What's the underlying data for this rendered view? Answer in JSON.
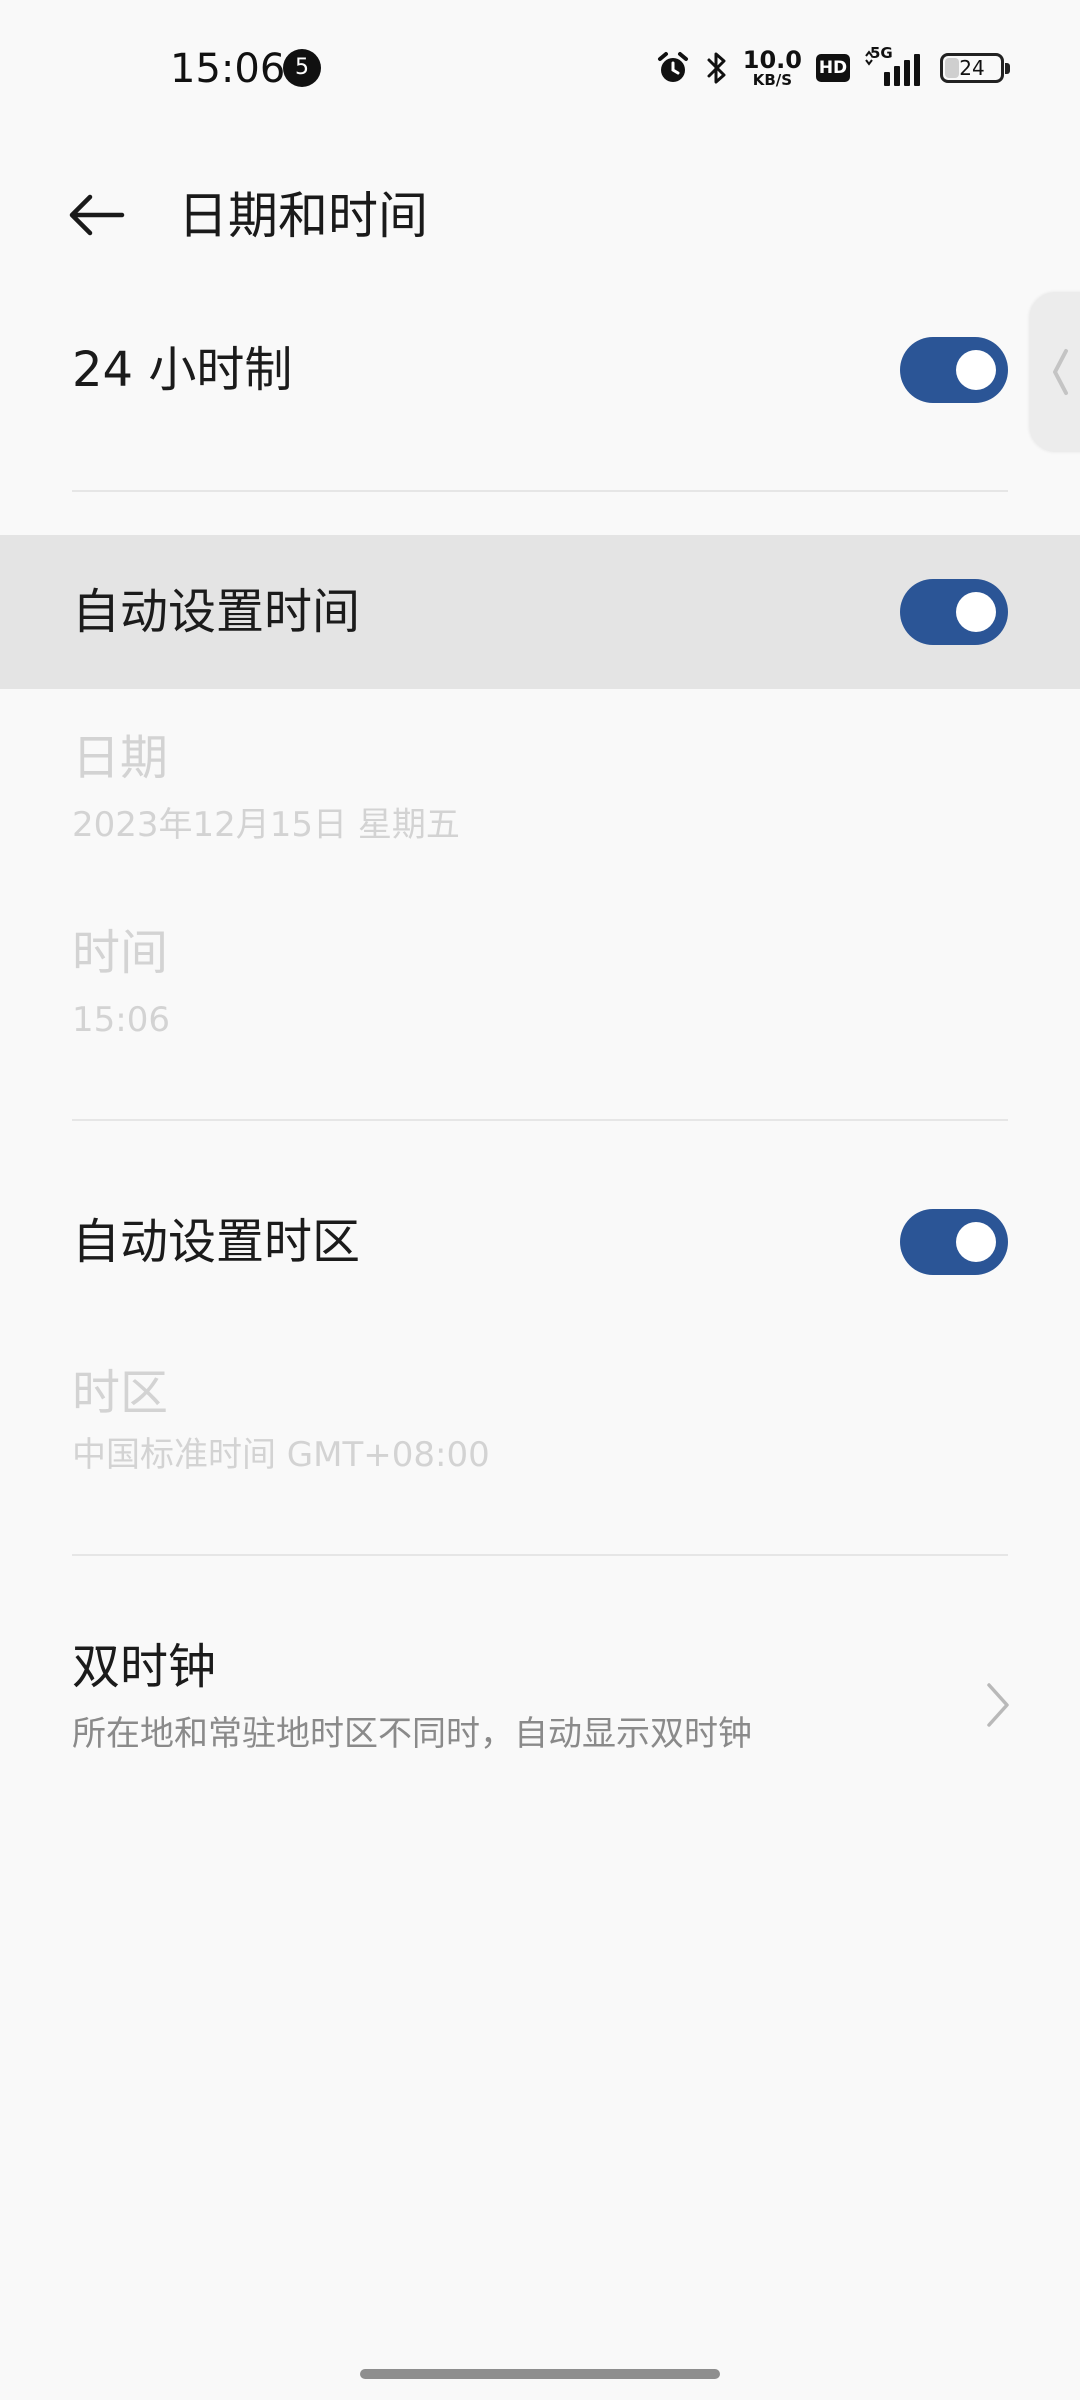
{
  "status_bar": {
    "time": "15:06",
    "notification_count": "5",
    "net_speed_value": "10.0",
    "net_speed_unit": "KB/S",
    "hd_label": "HD",
    "network_type": "5G",
    "battery_level": "24",
    "battery_fraction": 0.24
  },
  "app_bar": {
    "title": "日期和时间"
  },
  "settings": {
    "hour24": {
      "label": "24 小时制",
      "enabled": true
    },
    "auto_time": {
      "label": "自动设置时间",
      "enabled": true
    },
    "date": {
      "label": "日期",
      "value": "2023年12月15日 星期五"
    },
    "time": {
      "label": "时间",
      "value": "15:06"
    },
    "auto_timezone": {
      "label": "自动设置时区",
      "enabled": true
    },
    "timezone": {
      "label": "时区",
      "value": "中国标准时间 GMT+08:00"
    },
    "dual_clock": {
      "label": "双时钟",
      "description": "所在地和常驻地时区不同时，自动显示双时钟"
    }
  },
  "colors": {
    "accent": "#2b5596",
    "highlight": "#e4e4e4",
    "disabled_text": "#d3d3d3",
    "secondary_text": "#8a8a8a",
    "background": "#f9f9f9"
  },
  "icons": {
    "back": "arrow-left-icon",
    "alarm": "alarm-clock-icon",
    "bluetooth": "bluetooth-icon",
    "signal": "signal-bars-icon",
    "chevron": "chevron-right-icon",
    "edge_handle": "chevron-left-icon"
  }
}
